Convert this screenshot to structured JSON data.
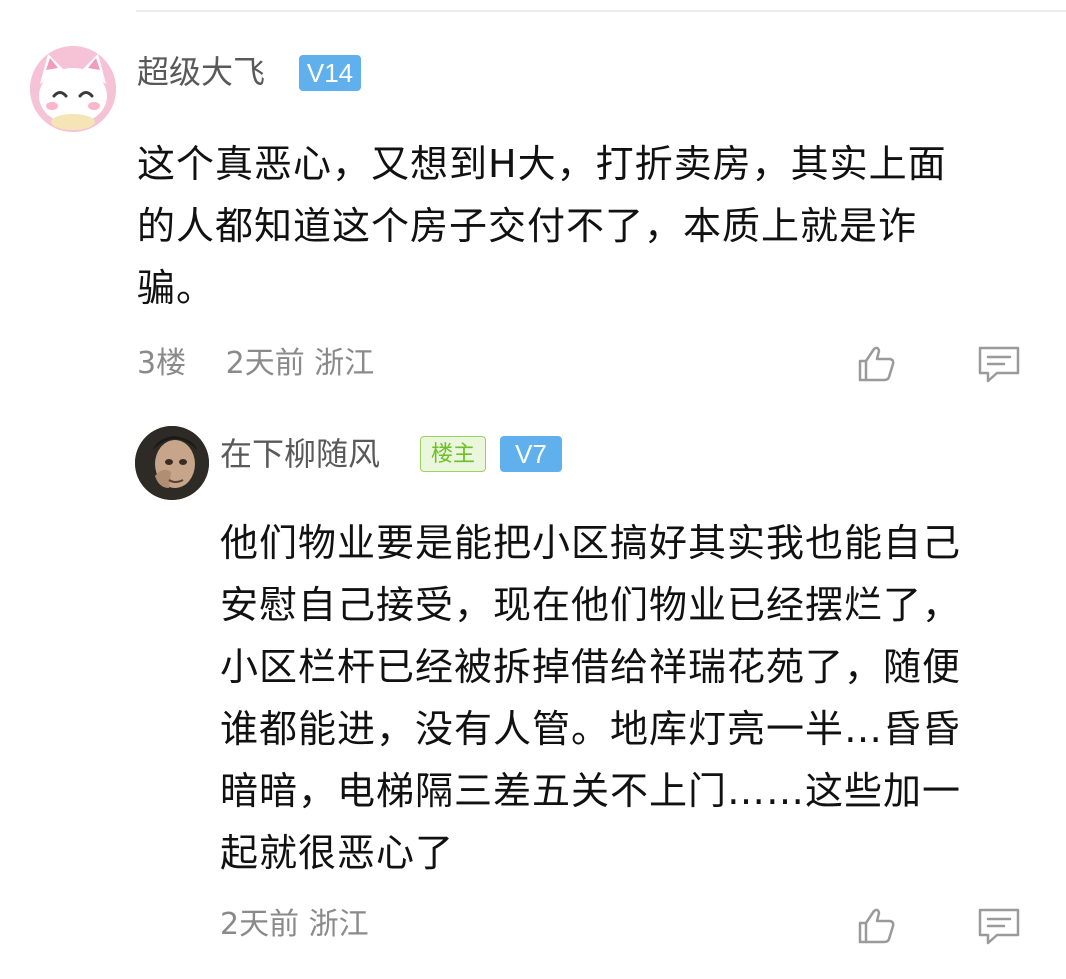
{
  "comment": {
    "username": "超级大飞",
    "level": "V14",
    "text": "这个真恶心，又想到H大，打折卖房，其实上面\n的人都知道这个房子交付不了，本质上就是诈\n骗。",
    "floor": "3楼",
    "time": "2天前",
    "location": "浙江",
    "like_icon": "thumbs-up-icon",
    "reply_icon": "comment-icon"
  },
  "reply": {
    "username": "在下柳随风",
    "op_badge": "楼主",
    "level": "V7",
    "text": "他们物业要是能把小区搞好其实我也能自己\n安慰自己接受，现在他们物业已经摆烂了，\n小区栏杆已经被拆掉借给祥瑞花苑了，随便\n谁都能进，没有人管。地库灯亮一半…昏昏\n暗暗，电梯隔三差五关不上门……这些加一\n起就很恶心了",
    "time": "2天前",
    "location": "浙江",
    "like_icon": "thumbs-up-icon",
    "reply_icon": "comment-icon"
  },
  "colors": {
    "level_badge": "#5fb0ec",
    "op_badge_text": "#6fbf2a",
    "meta_text": "#8a8a8a",
    "username_text": "#595959"
  }
}
